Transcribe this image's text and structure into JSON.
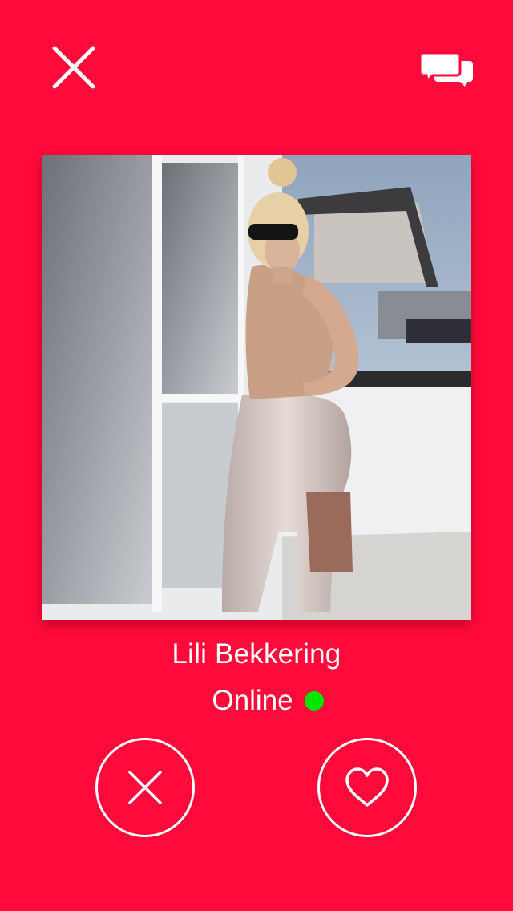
{
  "header": {
    "close_icon": "close-icon",
    "chat_icon": "chat-bubbles-icon"
  },
  "profile": {
    "name": "Lili Bekkering",
    "status": "Online",
    "status_color": "#00E600"
  },
  "actions": {
    "dislike_icon": "close-icon",
    "like_icon": "heart-icon"
  },
  "theme": {
    "background": "#FF0A3A",
    "foreground": "#FFFFFF"
  }
}
